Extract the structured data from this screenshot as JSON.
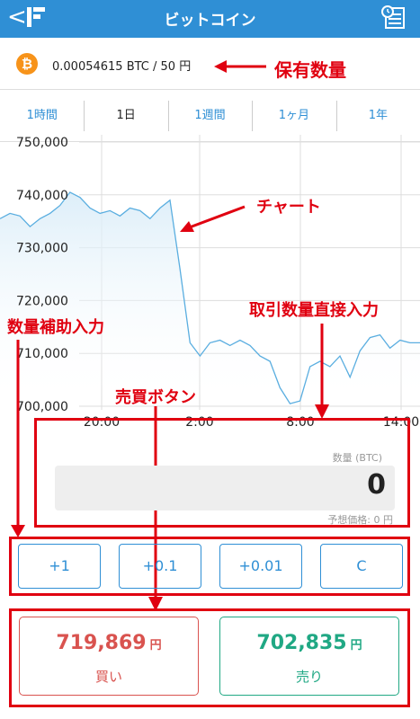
{
  "header": {
    "back_glyph": "<",
    "title": "ビットコイン"
  },
  "holding": {
    "coin_symbol": "₿",
    "amount": "0.00054615 BTC / 50 円"
  },
  "tabs": [
    "1時間",
    "1日",
    "1週間",
    "1ヶ月",
    "1年"
  ],
  "active_tab": "1日",
  "chart_data": {
    "type": "area",
    "y_ticks": [
      "750,000",
      "740,000",
      "730,000",
      "720,000",
      "710,000",
      "700,000"
    ],
    "x_ticks": [
      "20:00",
      "2:00",
      "8:00",
      "14:00"
    ],
    "ylim": [
      700000,
      750000
    ],
    "grid": true,
    "line_color": "#5aaee0",
    "series": [
      {
        "values": [
          735500,
          736500,
          736000,
          734000,
          735500,
          736500,
          738000,
          740500,
          739500,
          737500,
          736500,
          737000,
          736000,
          737500,
          737000,
          735500,
          737500,
          739000,
          726000,
          712000,
          709500,
          712000,
          712500,
          711500,
          712500,
          711500,
          709500,
          708500,
          703500,
          700500,
          701000,
          707500,
          708500,
          707500,
          709500,
          705500,
          710500,
          713000,
          713500,
          711000,
          712500,
          712000,
          712000
        ]
      }
    ]
  },
  "annotations": {
    "holding": "保有数量",
    "chart": "チャート",
    "qty_input": "取引数量直接入力",
    "qty_assist": "数量補助入力",
    "trade_buttons": "売買ボタン"
  },
  "quantity": {
    "label": "数量 (BTC)",
    "value": "0",
    "estimate": "予想価格: 0 円"
  },
  "assist_buttons": [
    "+1",
    "+0.1",
    "+0.01",
    "C"
  ],
  "buy": {
    "price": "719,869",
    "unit": "円",
    "label": "買い"
  },
  "sell": {
    "price": "702,835",
    "unit": "円",
    "label": "売り"
  },
  "colors": {
    "accent": "#2f8fd5",
    "annotation": "#e00010",
    "buy": "#d9534f",
    "sell": "#20a884"
  }
}
